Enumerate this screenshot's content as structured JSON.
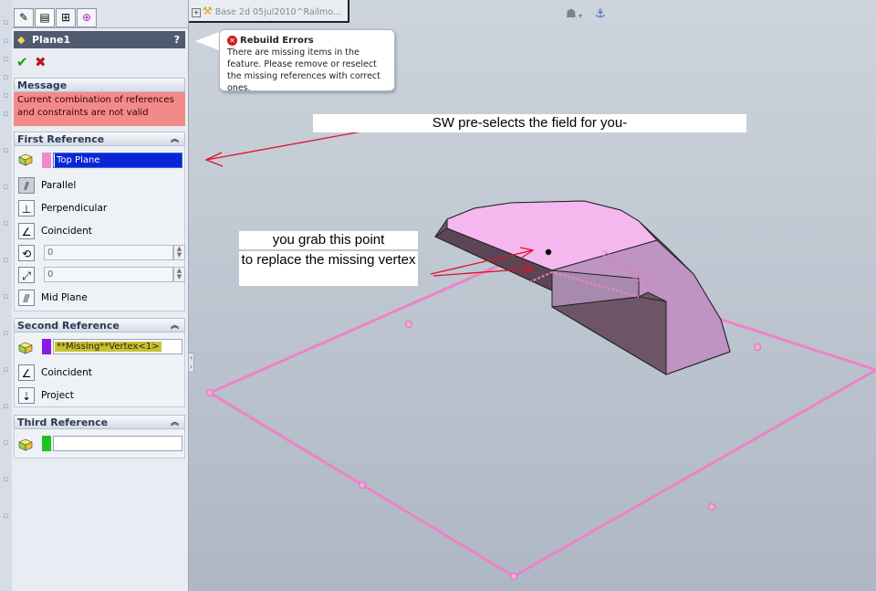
{
  "property_manager": {
    "tabs": [
      "feature-manager-tab",
      "property-manager-tab",
      "configuration-manager-tab",
      "dimxpert-manager-tab"
    ],
    "feature_title": "Plane1",
    "help_label": "?",
    "ok_symbol": "✔",
    "cancel_symbol": "✖",
    "message": {
      "header": "Message",
      "text": "Current combination of references and constraints are not valid",
      "color": "#f38a8a"
    },
    "first_reference": {
      "header": "First Reference",
      "value": "Top Plane",
      "swatch_color": "#f08ac8",
      "options": [
        "Parallel",
        "Perpendicular",
        "Coincident",
        "Mid Plane"
      ],
      "angle_value": "0",
      "distance_value": "0"
    },
    "second_reference": {
      "header": "Second Reference",
      "value": "**Missing**Vertex<1>",
      "swatch_color": "#8a1be0",
      "options": [
        "Coincident",
        "Project"
      ]
    },
    "third_reference": {
      "header": "Third Reference",
      "value": "",
      "swatch_color": "#1ec31e"
    }
  },
  "feature_tree": {
    "item": "Base 2d 05jul2010^Railmo..."
  },
  "tooltip": {
    "title": "Rebuild Errors",
    "body": "There are missing items in the feature. Please remove or reselect the missing references with correct ones."
  },
  "annotations": {
    "note1": "SW pre-selects the field for you-",
    "note2": "you grab this point",
    "note3": "to replace the missing vertex"
  },
  "model": {
    "plane_label": "Top Plane",
    "plane_color": "#f08ac8",
    "part_color": "#c98fcf"
  }
}
